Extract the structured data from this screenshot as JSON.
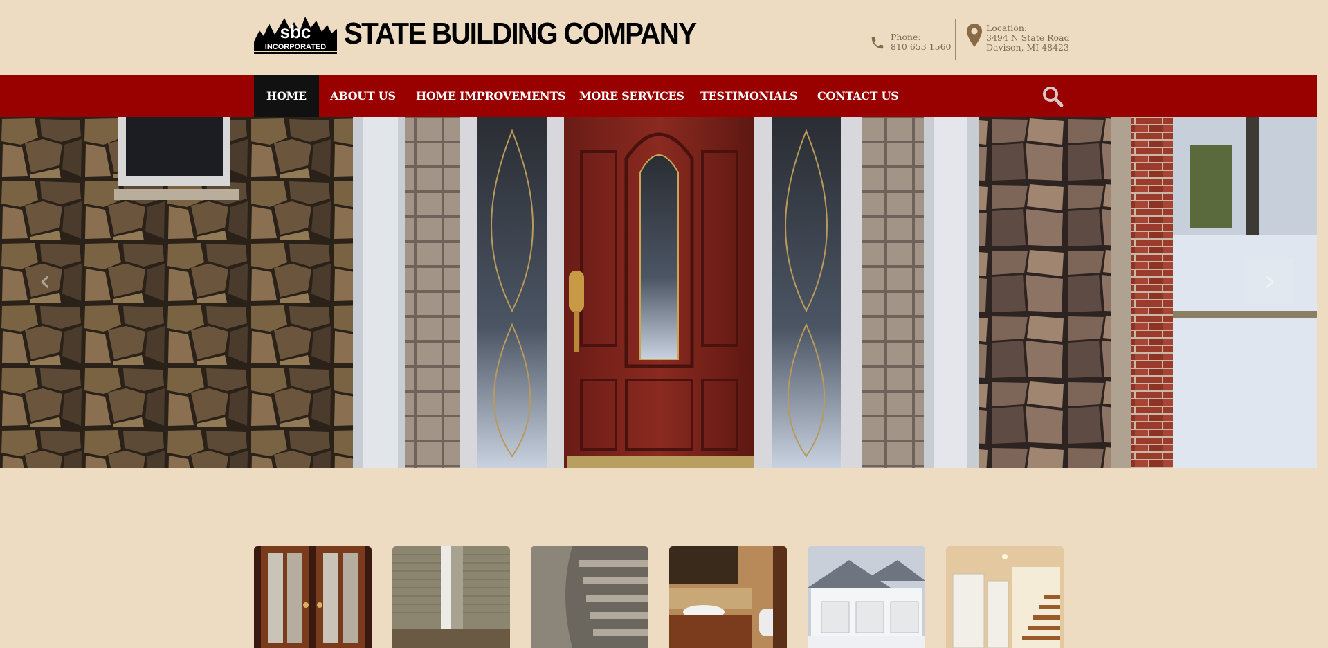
{
  "header": {
    "logo_text": "sbc",
    "logo_subtext": "INCORPORATED",
    "company_name": "STATE BUILDING COMPANY",
    "phone_label": "Phone:",
    "phone_number": "810 653 1560",
    "location_label": "Location:",
    "address_line1": "3494 N State Road",
    "address_line2": "Davison, MI 48423"
  },
  "nav": {
    "items": [
      {
        "label": "HOME",
        "active": true
      },
      {
        "label": "ABOUT US"
      },
      {
        "label": "HOME IMPROVEMENTS"
      },
      {
        "label": "MORE SERVICES"
      },
      {
        "label": "TESTIMONIALS"
      },
      {
        "label": "CONTACT US"
      }
    ],
    "search_icon": "search-icon"
  },
  "carousel": {
    "prev_icon": "chevron-left-icon",
    "next_icon": "chevron-right-icon",
    "prev_glyph": "‹",
    "next_glyph": "›"
  },
  "colors": {
    "background": "#eddcc2",
    "nav": "#990000",
    "nav_active": "#111111",
    "muted_text": "#7a6a55"
  }
}
